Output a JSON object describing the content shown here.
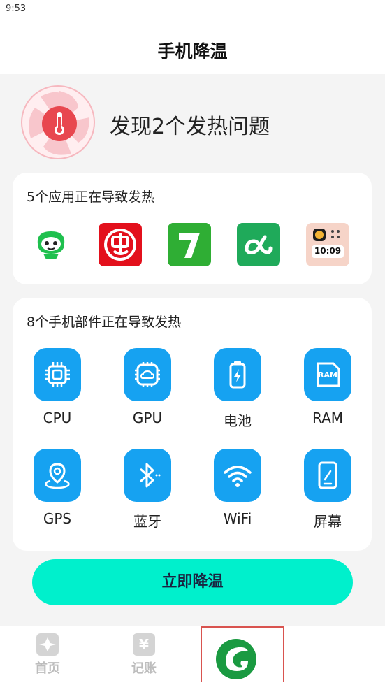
{
  "status": {
    "time": "9:53"
  },
  "header": {
    "title": "手机降温"
  },
  "hero": {
    "headline": "发现2个发热问题",
    "icon": "thermometer-fan-icon"
  },
  "apps_card": {
    "title": "5个应用正在导致发热",
    "apps": [
      {
        "name": "green-mascot-app-icon"
      },
      {
        "name": "red-character-app-icon"
      },
      {
        "name": "green-seven-app-icon"
      },
      {
        "name": "green-infinity-app-icon"
      },
      {
        "name": "clock-widget-app-icon",
        "text": "10:09"
      }
    ]
  },
  "parts_card": {
    "title": "8个手机部件正在导致发热",
    "parts": [
      {
        "label": "CPU",
        "icon": "chip-icon"
      },
      {
        "label": "GPU",
        "icon": "cloud-chip-icon"
      },
      {
        "label": "电池",
        "icon": "battery-icon"
      },
      {
        "label": "RAM",
        "icon": "ram-card-icon",
        "icon_text": "RAM"
      },
      {
        "label": "GPS",
        "icon": "location-pin-icon"
      },
      {
        "label": "蓝牙",
        "icon": "bluetooth-icon"
      },
      {
        "label": "WiFi",
        "icon": "wifi-icon"
      },
      {
        "label": "屏幕",
        "icon": "phone-screen-icon"
      }
    ]
  },
  "action": {
    "cool_label": "立即降温"
  },
  "tabbar": {
    "tabs": [
      {
        "label": "首页",
        "icon": "home-icon"
      },
      {
        "label": "记账",
        "icon": "yuan-icon",
        "icon_text": "¥"
      }
    ],
    "center_icon": "leaf-logo-icon"
  },
  "colors": {
    "accent_blue": "#16a2f1",
    "button_cyan": "#00f0cc",
    "hero_red": "#e8474f",
    "highlight_red": "#d9534f"
  }
}
